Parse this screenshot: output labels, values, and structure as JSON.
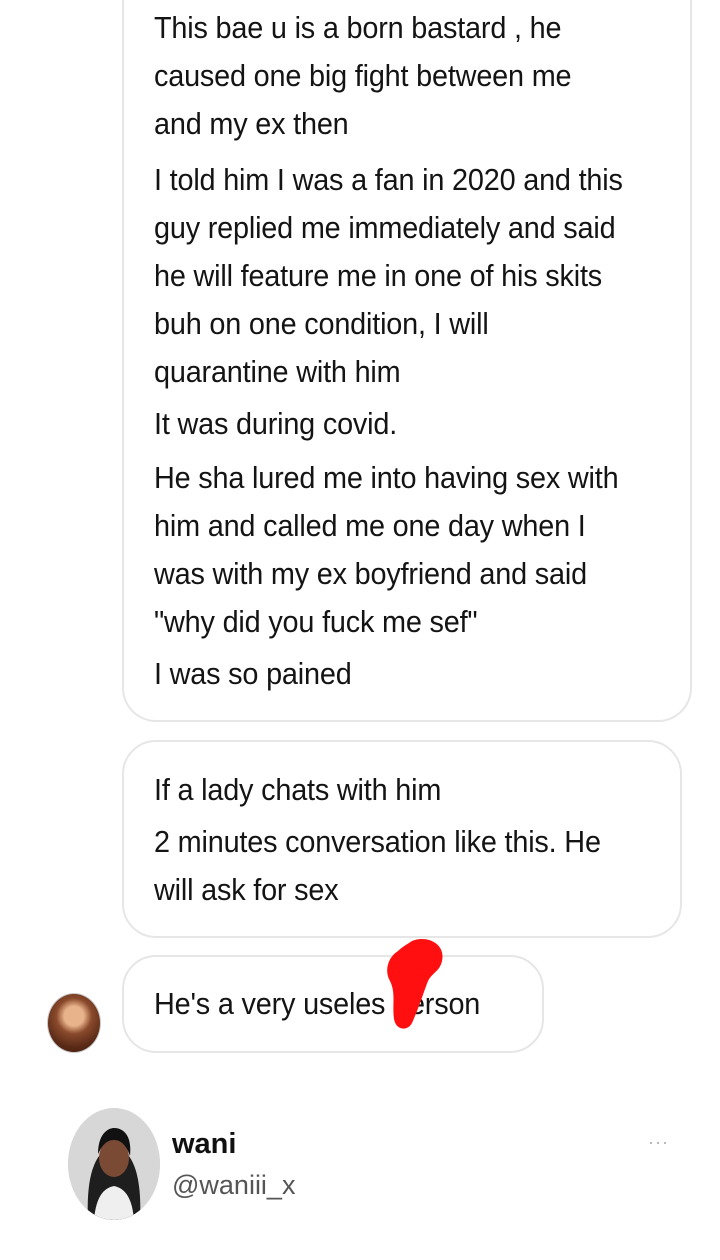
{
  "messages": [
    {
      "lines": [
        "This bae u is a born bastard , he",
        "caused one big fight between me",
        "and my ex then",
        "I told him I was a fan in 2020 and this",
        "guy replied me immediately and said",
        "he will feature me in one of his skits",
        "buh on one condition, I will",
        "quarantine with him",
        "It was during covid.",
        "He sha lured me into having sex with",
        "him and called me one day when I",
        "was with my ex boyfriend and said",
        "\"why did you fuck me sef\"",
        "I was so pained"
      ]
    },
    {
      "lines": [
        "If a lady chats with him",
        "2 minutes conversation like this.  He",
        "will ask for sex"
      ]
    },
    {
      "lines": [
        "He's a very useles  person"
      ]
    }
  ],
  "profile": {
    "name": "wani",
    "handle": "@waniii_x",
    "more_icon": "···"
  },
  "colors": {
    "scribble": "#ff0f0f",
    "bubble_border": "#e6e6e6"
  }
}
